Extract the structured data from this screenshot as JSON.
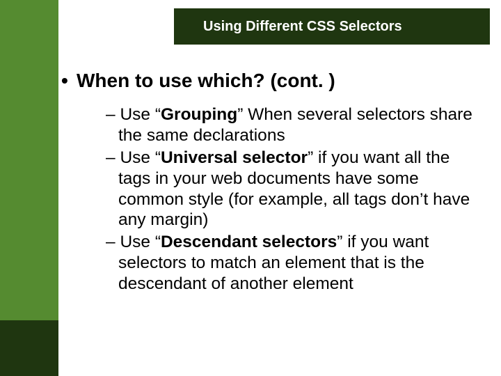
{
  "title": "Using Different CSS Selectors",
  "heading": "When to use which? (cont. )",
  "dash": "– ",
  "bullets": [
    {
      "pre": "Use “",
      "bold": "Grouping",
      "post": "” When several selectors share the same declarations"
    },
    {
      "pre": "Use “",
      "bold": "Universal selector",
      "post": "” if you want all the tags in your web documents have some common style (for example, all tags don’t have any margin)"
    },
    {
      "pre": "Use “",
      "bold": "Descendant selectors",
      "post": "” if you want selectors to match an element that is the descendant of another element"
    }
  ]
}
